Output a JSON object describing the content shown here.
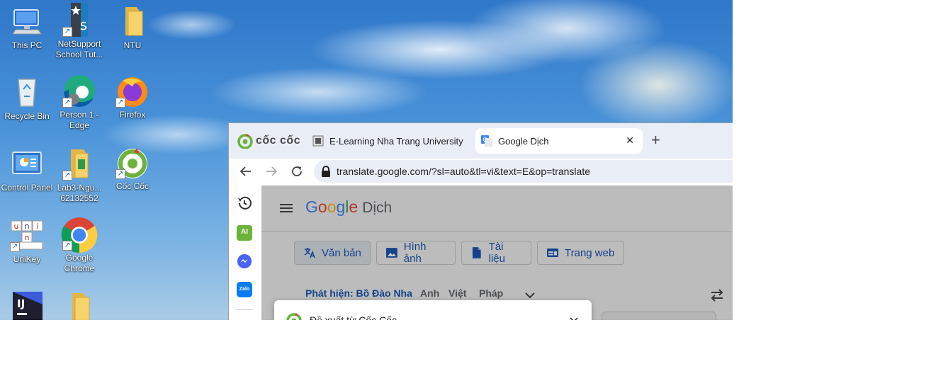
{
  "desktop": {
    "icons": [
      {
        "label": "This PC",
        "icon": "this-pc-icon"
      },
      {
        "label": "NetSupport School Tut...",
        "icon": "netsupport-icon"
      },
      {
        "label": "NTU",
        "icon": "folder-icon"
      },
      {
        "label": "Recycle Bin",
        "icon": "recycle-bin-icon"
      },
      {
        "label": "Person 1 - Edge",
        "icon": "edge-icon"
      },
      {
        "label": "Firefox",
        "icon": "firefox-icon"
      },
      {
        "label": "Control Panel",
        "icon": "control-panel-icon"
      },
      {
        "label": "Lab3-Ngu... 62132552",
        "icon": "folder-file-icon"
      },
      {
        "label": "Cốc Cốc",
        "icon": "coccoc-icon"
      },
      {
        "label": "UniKey",
        "icon": "unikey-icon"
      },
      {
        "label": "Google Chrome",
        "icon": "chrome-icon"
      },
      {
        "label": "",
        "icon": "intellij-icon"
      },
      {
        "label": "",
        "icon": "folder-icon"
      }
    ]
  },
  "browser": {
    "brand": "cốc cốc",
    "tabs": [
      {
        "title": "E-Learning Nha Trang University",
        "active": false
      },
      {
        "title": "Google Dịch",
        "active": true
      }
    ],
    "new_tab_symbol": "+",
    "close_symbol": "✕",
    "url": "translate.google.com/?sl=auto&tl=vi&text=E&op=translate",
    "sidebar_ai": "AI",
    "sidebar_zalo": "Zalo"
  },
  "translate": {
    "logo_letters": [
      "G",
      "o",
      "o",
      "g",
      "l",
      "e"
    ],
    "product": "Dịch",
    "modes": [
      "Văn bản",
      "Hình ảnh",
      "Tài liệu",
      "Trang web"
    ],
    "detect": "Phát hiện: Bồ Đào Nha",
    "langs": [
      "Anh",
      "Việt",
      "Pháp"
    ]
  },
  "popup": {
    "title": "Đề xuất từ Cốc Cốc"
  },
  "colors": {
    "google_blue": "#4285f4",
    "google_red": "#ea4335",
    "google_yellow": "#fbbc05",
    "google_green": "#34a853",
    "coccoc_green": "#7cb342",
    "link_blue": "#1a56b3"
  }
}
